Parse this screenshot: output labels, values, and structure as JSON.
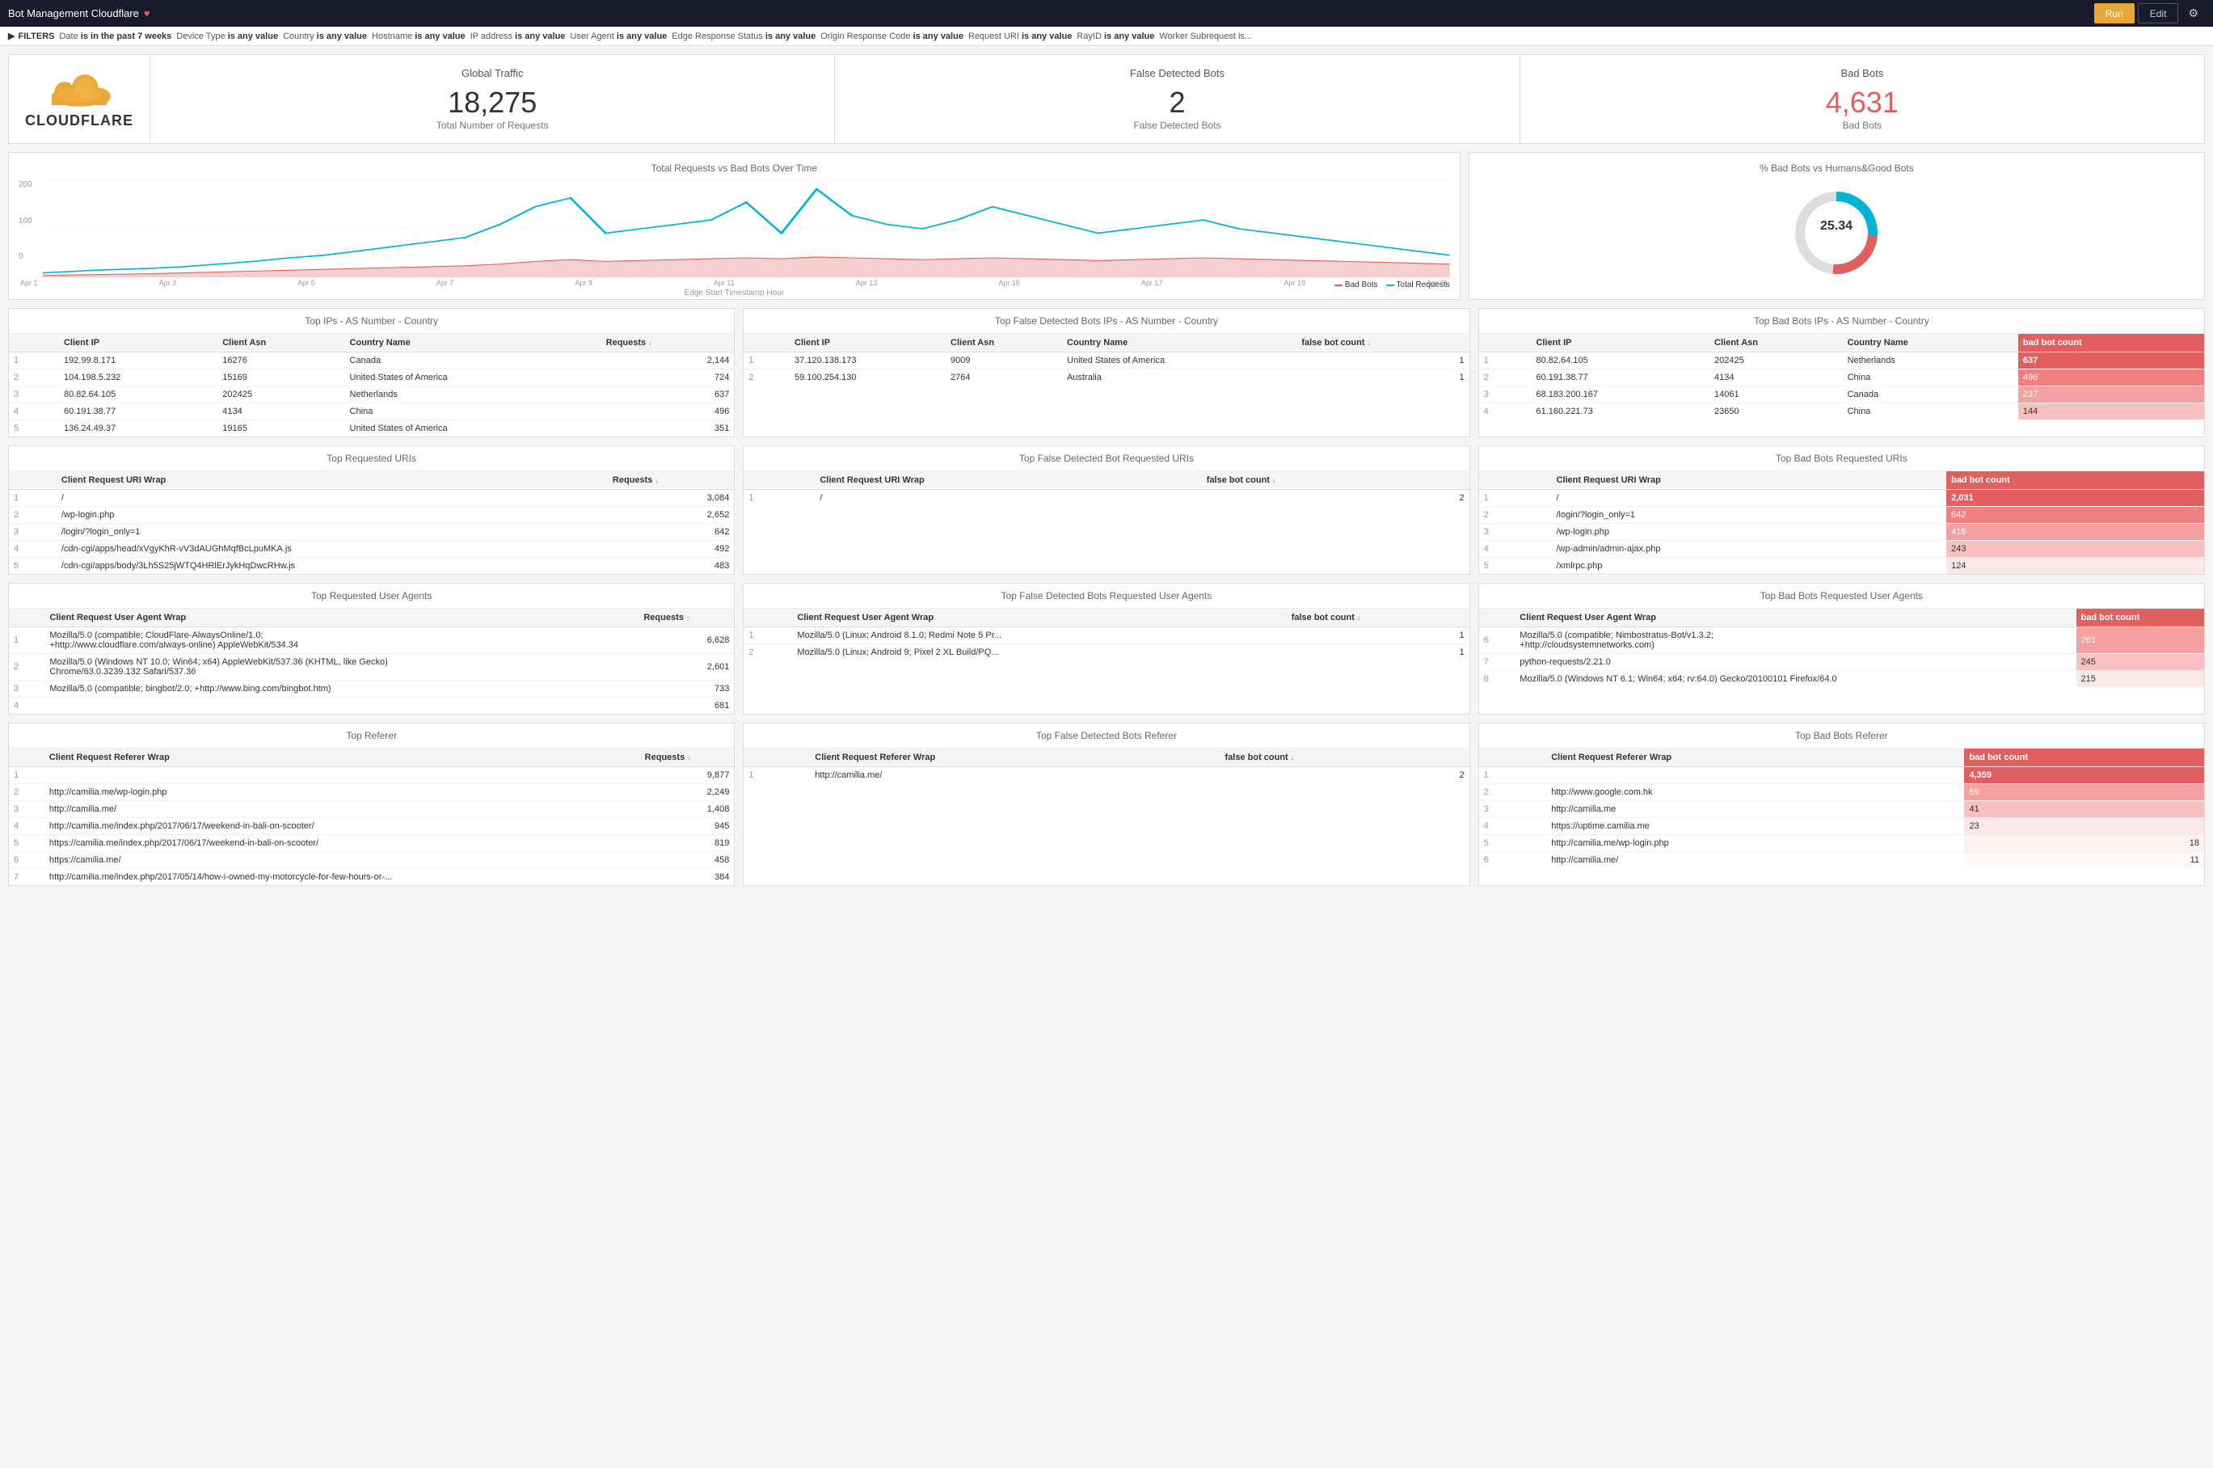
{
  "topbar": {
    "title": "Bot Management Cloudflare",
    "heart_icon": "♥",
    "btn_run": "Run",
    "btn_edit": "Edit",
    "gear_icon": "⚙"
  },
  "filters": {
    "label": "FILTERS",
    "items": [
      {
        "key": "Date",
        "op": "is in the past",
        "val": "7 weeks"
      },
      {
        "key": "Device Type",
        "op": "is",
        "val": "any value"
      },
      {
        "key": "Country",
        "op": "is",
        "val": "any value"
      },
      {
        "key": "Hostname",
        "op": "is",
        "val": "any value"
      },
      {
        "key": "IP address",
        "op": "is",
        "val": "any value"
      },
      {
        "key": "User Agent",
        "op": "is",
        "val": "any value"
      },
      {
        "key": "Edge Response Status",
        "op": "is",
        "val": "any value"
      },
      {
        "key": "Origin Response Code",
        "op": "is",
        "val": "any value"
      },
      {
        "key": "Request URI",
        "op": "is",
        "val": "any value"
      },
      {
        "key": "RayID",
        "op": "is",
        "val": "any value"
      },
      {
        "key": "Worker Subrequest",
        "op": "is...",
        "val": ""
      }
    ]
  },
  "global_traffic": {
    "section_title": "Global Traffic",
    "value": "18,275",
    "label": "Total Number of Requests"
  },
  "false_detected_bots": {
    "section_title": "False Detected Bots",
    "value": "2",
    "label": "False Detected Bots"
  },
  "bad_bots": {
    "section_title": "Bad Bots",
    "value": "4,631",
    "label": "Bad Bots"
  },
  "chart_time": {
    "title": "Total Requests vs Bad Bots Over Time",
    "y_labels": [
      "200",
      "100",
      "0"
    ],
    "x_labels": [
      "Apr 1",
      "Apr 3",
      "Apr 5",
      "Apr 7",
      "Apr 9",
      "Apr 11",
      "Apr 13",
      "Apr 15",
      "Apr 17",
      "Apr 19",
      "Apr 21"
    ],
    "x_axis_label": "Edge Start Timestamp Hour",
    "legend_bad_bots": "Bad Bots",
    "legend_total": "Total Requests"
  },
  "chart_donut": {
    "title": "% Bad Bots vs Humans&Good Bots",
    "value": "25.34",
    "pct": 25.34
  },
  "top_ips": {
    "title": "Top IPs - AS Number - Country",
    "headers": [
      "Client IP",
      "Client Asn",
      "Country Name",
      "Requests"
    ],
    "rows": [
      {
        "num": 1,
        "ip": "192.99.8.171",
        "asn": "16276",
        "country": "Canada",
        "requests": "2,144"
      },
      {
        "num": 2,
        "ip": "104.198.5.232",
        "asn": "15169",
        "country": "United States of America",
        "requests": "724"
      },
      {
        "num": 3,
        "ip": "80.82.64.105",
        "asn": "202425",
        "country": "Netherlands",
        "requests": "637"
      },
      {
        "num": 4,
        "ip": "60.191.38.77",
        "asn": "4134",
        "country": "China",
        "requests": "496"
      },
      {
        "num": 5,
        "ip": "136.24.49.37",
        "asn": "19165",
        "country": "United States of America",
        "requests": "351"
      }
    ]
  },
  "top_false_ips": {
    "title": "Top False Detected Bots IPs - AS Number - Country",
    "headers": [
      "Client IP",
      "Client Asn",
      "Country Name",
      "false bot count"
    ],
    "rows": [
      {
        "num": 1,
        "ip": "37.120.138.173",
        "asn": "9009",
        "country": "United States of America",
        "count": "1"
      },
      {
        "num": 2,
        "ip": "59.100.254.130",
        "asn": "2764",
        "country": "Australia",
        "count": "1"
      }
    ]
  },
  "top_bad_bots_ips": {
    "title": "Top Bad Bots IPs - AS Number - Country",
    "headers": [
      "Client IP",
      "Client Asn",
      "Country Name",
      "bad bot count"
    ],
    "rows": [
      {
        "num": 1,
        "ip": "80.82.64.105",
        "asn": "202425",
        "country": "Netherlands",
        "count": "637",
        "level": "high"
      },
      {
        "num": 2,
        "ip": "60.191.38.77",
        "asn": "4134",
        "country": "China",
        "count": "496",
        "level": "med"
      },
      {
        "num": 3,
        "ip": "68.183.200.167",
        "asn": "14061",
        "country": "Canada",
        "count": "237",
        "level": "low"
      },
      {
        "num": 4,
        "ip": "61.160.221.73",
        "asn": "23650",
        "country": "China",
        "count": "144",
        "level": "vlow"
      }
    ]
  },
  "top_uris": {
    "title": "Top Requested URIs",
    "headers": [
      "Client Request URI Wrap",
      "Requests"
    ],
    "rows": [
      {
        "num": 1,
        "uri": "/",
        "requests": "3,084"
      },
      {
        "num": 2,
        "uri": "/wp-login.php",
        "requests": "2,652"
      },
      {
        "num": 3,
        "uri": "/login/?login_only=1",
        "requests": "642"
      },
      {
        "num": 4,
        "uri": "/cdn-cgi/apps/head/xVgyKhR-vV3dAUGhMqfBcLpuMKA.js",
        "requests": "492"
      },
      {
        "num": 5,
        "uri": "/cdn-cgi/apps/body/3Lh5S25jWTQ4HRlErJykHqDwcRHw.js",
        "requests": "483"
      }
    ]
  },
  "top_false_uris": {
    "title": "Top False Detected Bot Requested URIs",
    "headers": [
      "Client Request URI Wrap",
      "false bot count"
    ],
    "rows": [
      {
        "num": 1,
        "uri": "/",
        "count": "2"
      }
    ]
  },
  "top_bad_uris": {
    "title": "Top Bad Bots Requested URIs",
    "headers": [
      "Client Request URI Wrap",
      "bad bot count"
    ],
    "rows": [
      {
        "num": 1,
        "uri": "/",
        "count": "2,031",
        "level": "high"
      },
      {
        "num": 2,
        "uri": "/login/?login_only=1",
        "count": "642",
        "level": "med"
      },
      {
        "num": 3,
        "uri": "/wp-login.php",
        "count": "416",
        "level": "low2"
      },
      {
        "num": 4,
        "uri": "/wp-admin/admin-ajax.php",
        "count": "243",
        "level": "low3"
      },
      {
        "num": 5,
        "uri": "/xmlrpc.php",
        "count": "124",
        "level": "vlow"
      }
    ]
  },
  "top_agents": {
    "title": "Top Requested User Agents",
    "headers": [
      "Client Request User Agent Wrap",
      "Requests"
    ],
    "rows": [
      {
        "num": 1,
        "agent": "Mozilla/5.0 (compatible; CloudFlare-AlwaysOnline/1.0; +http://www.cloudflare.com/always-online) AppleWebKit/534.34",
        "requests": "6,628"
      },
      {
        "num": 2,
        "agent": "Mozilla/5.0 (Windows NT 10.0; Win64; x64) AppleWebKit/537.36 (KHTML, like Gecko) Chrome/63.0.3239.132 Safari/537.36",
        "requests": "2,601"
      },
      {
        "num": 3,
        "agent": "Mozilla/5.0 (compatible; bingbot/2.0; +http://www.bing.com/bingbot.htm)",
        "requests": "733"
      },
      {
        "num": 4,
        "agent": "",
        "requests": "681"
      }
    ]
  },
  "top_false_agents": {
    "title": "Top False Detected Bots Requested User Agents",
    "headers": [
      "Client Request User Agent Wrap",
      "false bot count"
    ],
    "rows": [
      {
        "num": 1,
        "agent": "Mozilla/5.0 (Linux; Android 8.1.0; Redmi Note 5 Pr...",
        "count": "1"
      },
      {
        "num": 2,
        "agent": "Mozilla/5.0 (Linux; Android 9; Pixel 2 XL Build/PQ...",
        "count": "1"
      }
    ]
  },
  "top_bad_agents": {
    "title": "Top Bad Bots Requested User Agents",
    "headers": [
      "Client Request User Agent Wrap",
      "bad bot count"
    ],
    "rows": [
      {
        "num": 6,
        "agent": "Mozilla/5.0 (compatible; Nimbostratus-Bot/v1.3.2; +http://cloudsystemnetworks.com)",
        "count": "261",
        "level": "low"
      },
      {
        "num": 7,
        "agent": "python-requests/2.21.0",
        "count": "245",
        "level": "low2"
      },
      {
        "num": 8,
        "agent": "Mozilla/5.0 (Windows NT 6.1; Win64; x64; rv:64.0) Gecko/20100101 Firefox/64.0",
        "count": "215",
        "level": "low3"
      }
    ]
  },
  "top_referer": {
    "title": "Top Referer",
    "headers": [
      "Client Request Referer Wrap",
      "Requests"
    ],
    "rows": [
      {
        "num": 1,
        "ref": "",
        "requests": "9,877"
      },
      {
        "num": 2,
        "ref": "http://camilia.me/wp-login.php",
        "requests": "2,249"
      },
      {
        "num": 3,
        "ref": "http://camilia.me/",
        "requests": "1,408"
      },
      {
        "num": 4,
        "ref": "http://camilia.me/index.php/2017/06/17/weekend-in-bali-on-scooter/",
        "requests": "945"
      },
      {
        "num": 5,
        "ref": "https://camilia.me/index.php/2017/06/17/weekend-in-bali-on-scooter/",
        "requests": "819"
      },
      {
        "num": 6,
        "ref": "https://camilia.me/",
        "requests": "458"
      },
      {
        "num": 7,
        "ref": "http://camilia.me/index.php/2017/05/14/how-i-owned-my-motorcycle-for-few-hours-or-...",
        "requests": "384"
      }
    ]
  },
  "top_false_referer": {
    "title": "Top False Detected Bots Referer",
    "headers": [
      "Client Request Referer Wrap",
      "false bot count"
    ],
    "rows": [
      {
        "num": 1,
        "ref": "http://camilia.me/",
        "count": "2"
      }
    ]
  },
  "top_bad_referer": {
    "title": "Top Bad Bots Referer",
    "headers": [
      "Client Request Referer Wrap",
      "bad bot count"
    ],
    "rows": [
      {
        "num": 1,
        "ref": "",
        "count": "4,359",
        "level": "high"
      },
      {
        "num": 2,
        "ref": "http://www.google.com.hk",
        "count": "69",
        "level": "low"
      },
      {
        "num": 3,
        "ref": "http://camilia.me",
        "count": "41",
        "level": "vlow"
      },
      {
        "num": 4,
        "ref": "https://uptime.camilia.me",
        "count": "23",
        "level": "vlow2"
      },
      {
        "num": 5,
        "ref": "http://camilia.me/wp-login.php",
        "count": "18",
        "level": "vlow3"
      },
      {
        "num": 6,
        "ref": "http://camilia.me/",
        "count": "11",
        "level": "vlow4"
      }
    ]
  }
}
